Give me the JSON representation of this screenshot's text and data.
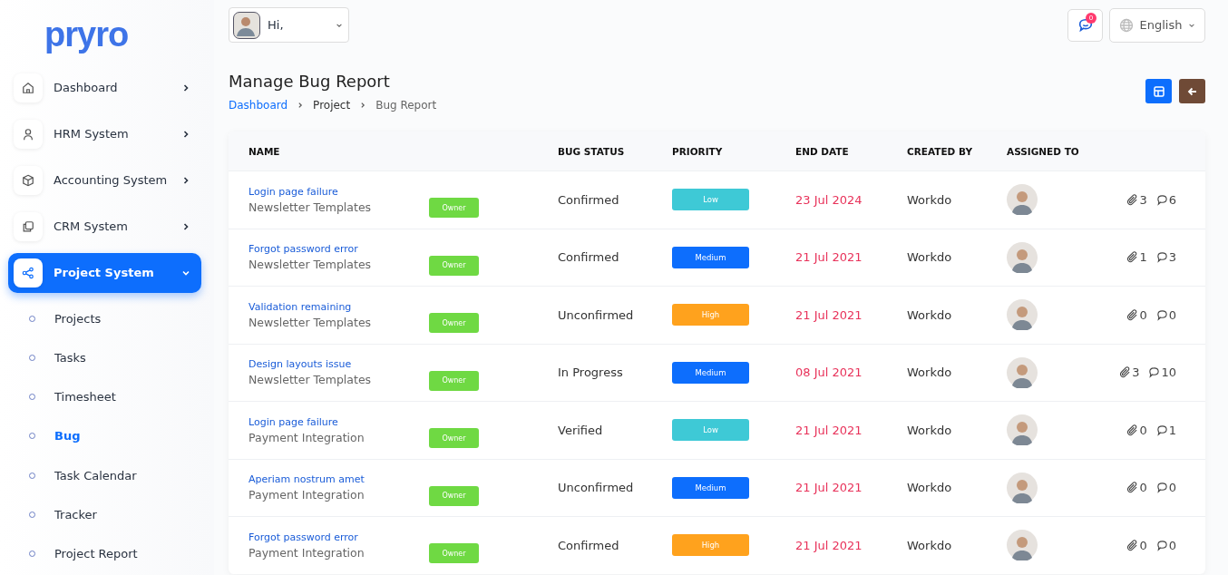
{
  "logo": "pryro",
  "sidebar": {
    "items": [
      {
        "label": "Dashboard",
        "selected": false,
        "expanded": false
      },
      {
        "label": "HRM System",
        "selected": false,
        "expanded": false
      },
      {
        "label": "Accounting System",
        "selected": false,
        "expanded": false
      },
      {
        "label": "CRM System",
        "selected": false,
        "expanded": false
      },
      {
        "label": "Project System",
        "selected": true,
        "expanded": true,
        "children": [
          {
            "label": "Projects",
            "selected": false
          },
          {
            "label": "Tasks",
            "selected": false
          },
          {
            "label": "Timesheet",
            "selected": false
          },
          {
            "label": "Bug",
            "selected": true
          },
          {
            "label": "Task Calendar",
            "selected": false
          },
          {
            "label": "Tracker",
            "selected": false
          },
          {
            "label": "Project Report",
            "selected": false
          }
        ]
      }
    ]
  },
  "topbar": {
    "greeting": "Hi,",
    "notifications": "0",
    "language": "English"
  },
  "page": {
    "title": "Manage Bug Report",
    "breadcrumb": [
      "Dashboard",
      "Project",
      "Bug Report"
    ]
  },
  "table": {
    "columns": [
      "NAME",
      "BUG STATUS",
      "PRIORITY",
      "END DATE",
      "CREATED BY",
      "ASSIGNED TO"
    ],
    "rows": [
      {
        "title": "Login page failure",
        "project": "Newsletter Templates",
        "role": "Owner",
        "status": "Confirmed",
        "priority": {
          "label": "Low",
          "color": "#3ec9d6"
        },
        "end_date": "23 Jul 2024",
        "created_by": "Workdo",
        "attachments": "3",
        "comments": "6"
      },
      {
        "title": "Forgot password error",
        "project": "Newsletter Templates",
        "role": "Owner",
        "status": "Confirmed",
        "priority": {
          "label": "Medium",
          "color": "#0d6efd"
        },
        "end_date": "21 Jul 2021",
        "created_by": "Workdo",
        "attachments": "1",
        "comments": "3"
      },
      {
        "title": "Validation remaining",
        "project": "Newsletter Templates",
        "role": "Owner",
        "status": "Unconfirmed",
        "priority": {
          "label": "High",
          "color": "#ffa21d"
        },
        "end_date": "21 Jul 2021",
        "created_by": "Workdo",
        "attachments": "0",
        "comments": "0"
      },
      {
        "title": "Design layouts issue",
        "project": "Newsletter Templates",
        "role": "Owner",
        "status": "In Progress",
        "priority": {
          "label": "Medium",
          "color": "#0d6efd"
        },
        "end_date": "08 Jul 2021",
        "created_by": "Workdo",
        "attachments": "3",
        "comments": "10"
      },
      {
        "title": "Login page failure",
        "project": "Payment Integration",
        "role": "Owner",
        "status": "Verified",
        "priority": {
          "label": "Low",
          "color": "#3ec9d6"
        },
        "end_date": "21 Jul 2021",
        "created_by": "Workdo",
        "attachments": "0",
        "comments": "1"
      },
      {
        "title": "Aperiam nostrum amet",
        "project": "Payment Integration",
        "role": "Owner",
        "status": "Unconfirmed",
        "priority": {
          "label": "Medium",
          "color": "#0d6efd"
        },
        "end_date": "21 Jul 2021",
        "created_by": "Workdo",
        "attachments": "0",
        "comments": "0"
      },
      {
        "title": "Forgot password error",
        "project": "Payment Integration",
        "role": "Owner",
        "status": "Confirmed",
        "priority": {
          "label": "High",
          "color": "#ffa21d"
        },
        "end_date": "21 Jul 2021",
        "created_by": "Workdo",
        "attachments": "0",
        "comments": "0"
      }
    ]
  }
}
